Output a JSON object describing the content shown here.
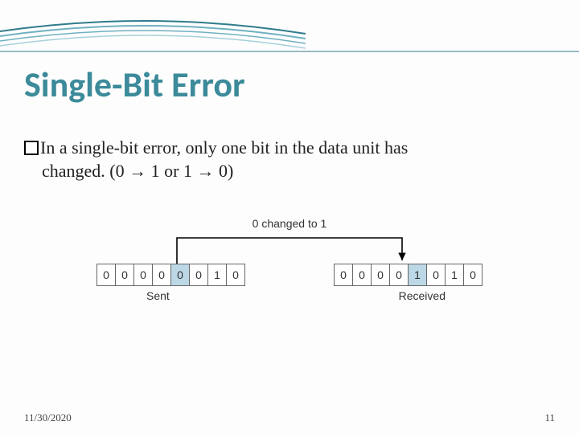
{
  "title": "Single-Bit Error",
  "body": {
    "line1": "In a single-bit error, only one bit in the data unit has",
    "line2": "changed. (0 → 1 or 1 → 0)"
  },
  "diagram": {
    "change_label": "0 changed to 1",
    "sent": {
      "bits": [
        "0",
        "0",
        "0",
        "0",
        "0",
        "0",
        "1",
        "0"
      ],
      "highlight_index": 4,
      "label": "Sent"
    },
    "received": {
      "bits": [
        "0",
        "0",
        "0",
        "0",
        "1",
        "0",
        "1",
        "0"
      ],
      "highlight_index": 4,
      "label": "Received"
    }
  },
  "footer": {
    "date": "11/30/2020",
    "page": "11"
  }
}
